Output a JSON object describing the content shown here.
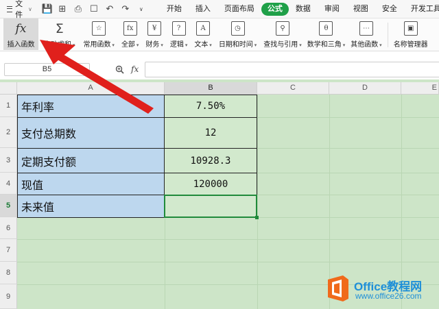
{
  "menu": {
    "file_label": "文件",
    "tabs": [
      "开始",
      "插入",
      "页面布局",
      "公式",
      "数据",
      "审阅",
      "视图",
      "安全",
      "开发工具"
    ],
    "active_tab": "公式"
  },
  "ribbon": {
    "insert_function": "插入函数",
    "autosum": "自动求和",
    "common": "常用函数",
    "all": "全部",
    "finance": "财务",
    "logic": "逻辑",
    "text": "文本",
    "datetime": "日期和时间",
    "lookup": "查找与引用",
    "math": "数学和三角",
    "other": "其他函数",
    "name_manager": "名称管理器"
  },
  "formula_bar": {
    "name_box": "B5",
    "fx": "fx",
    "formula": ""
  },
  "columns": [
    "A",
    "B",
    "C",
    "D",
    "E"
  ],
  "selected_column": "B",
  "rows": [
    "1",
    "2",
    "3",
    "4",
    "5",
    "6",
    "7",
    "8",
    "9"
  ],
  "selected_row": "5",
  "table": [
    {
      "label": "年利率",
      "value": "7.50%"
    },
    {
      "label": "支付总期数",
      "value": "12"
    },
    {
      "label": "定期支付额",
      "value": "10928.3"
    },
    {
      "label": "现值",
      "value": "120000"
    },
    {
      "label": "未来值",
      "value": ""
    }
  ],
  "watermark": {
    "title": "Office教程网",
    "url": "www.office26.com"
  },
  "colors": {
    "accent": "#1fa048",
    "cell_label_bg": "#bdd7ee",
    "sheet_bg": "#cde5c8",
    "arrow": "#e0201c",
    "watermark_orange": "#f06a1b",
    "watermark_blue": "#1e8fd8"
  }
}
